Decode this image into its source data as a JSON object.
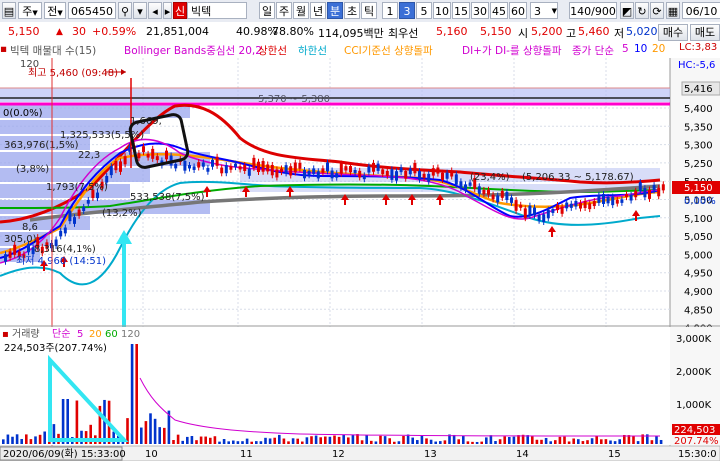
{
  "toolbar": {
    "market": "주",
    "market_type": "전",
    "code": "065450",
    "name": "빅텍",
    "name_badge": "신",
    "periods": [
      "일",
      "주",
      "월",
      "년",
      "분",
      "초",
      "틱"
    ],
    "selected_period": "분",
    "intervals": [
      "1",
      "3",
      "5",
      "10",
      "15",
      "30",
      "45",
      "60"
    ],
    "selected_interval": "3",
    "interval_input": "3",
    "count": "140/900",
    "date": "06/10"
  },
  "quote": {
    "price": "5,150",
    "arrow": "▲",
    "change": "30",
    "change_pct": "+0.59%",
    "volume": "21,851,004",
    "vol_ratio": "40.98%",
    "turnover": "78.80%",
    "amount": "114,095백만",
    "priority_label": "최우선",
    "priority_price": "5,160",
    "open_price": "5,150",
    "open_label": "시",
    "open_value": "5,200",
    "high_label": "고",
    "high_value": "5,460",
    "low_label": "저",
    "low_value": "5,020",
    "buy_button": "매수",
    "sell_button": "매도"
  },
  "legend": {
    "title": "빅텍 매물대 수(15)",
    "bb": "Bollinger Bands중심선 20,2",
    "upper": "상한선",
    "lower": "하한선",
    "cci": "CCI기준선 상향돌파",
    "di": "DI+가 DI-를 상향돌파",
    "close": "종가 단순",
    "ma5": "5",
    "ma10": "10",
    "ma20": "20",
    "right_lc": "LC:3,83",
    "right_hc": "HC:-5,6"
  },
  "colors": {
    "ma5": "#d000d0",
    "ma10": "#0000ff",
    "ma20": "#ff9900",
    "bb_mid": "#00aa00",
    "bb_upper": "#dd0000",
    "bb_lower": "#00aacc",
    "up": "#e00000",
    "down": "#0033cc",
    "profile": "#9aa6ee",
    "highlight": "#ff00cc",
    "annotation": "#33e6f2"
  },
  "price_axis": {
    "ticks": [
      "5,400",
      "5,350",
      "5,300",
      "5,250",
      "5,200",
      "5,150",
      "5,100",
      "5,050",
      "5,000",
      "4,950",
      "4,900",
      "4,850",
      "4,800"
    ],
    "current_label": "5,150",
    "current_pct": "0.00%",
    "top_label": "5,416"
  },
  "volume_axis": {
    "ticks": [
      "3,000K",
      "2,000K",
      "1,000K"
    ],
    "current_label": "224,503",
    "current_pct": "207.74%"
  },
  "volume_legend": {
    "title": "거래량",
    "simple": "단순",
    "ma5": "5",
    "ma20": "20",
    "ma60": "60",
    "ma120": "120",
    "readout": "224,503주(207.74%)"
  },
  "annotations": {
    "high": "최고 5,460 (09:48)",
    "low": "최저 4,960 (14:51)",
    "highlight_band": "5,370 ~ 5,380",
    "top_row": "0(0.0%)",
    "left_label_120": "120",
    "profile_labels": [
      "1,669,",
      "1,325,533(5,5%)",
      "363,976(1,5%)",
      "1,793(7,5%)",
      "22,3",
      "(3,8%)",
      "533,538(7,5%)",
      "(13,2%)",
      "8,6",
      "305,0)",
      "8,316(4,1%)",
      "(23,4%)",
      "(5,206.33 ~ 5,178.67)"
    ]
  },
  "time_axis": {
    "cursor_label": "2020/06/09(화) 15:33:00",
    "ticks": [
      "10",
      "11",
      "12",
      "13",
      "14",
      "15"
    ],
    "right_label": "15:30:0"
  }
}
